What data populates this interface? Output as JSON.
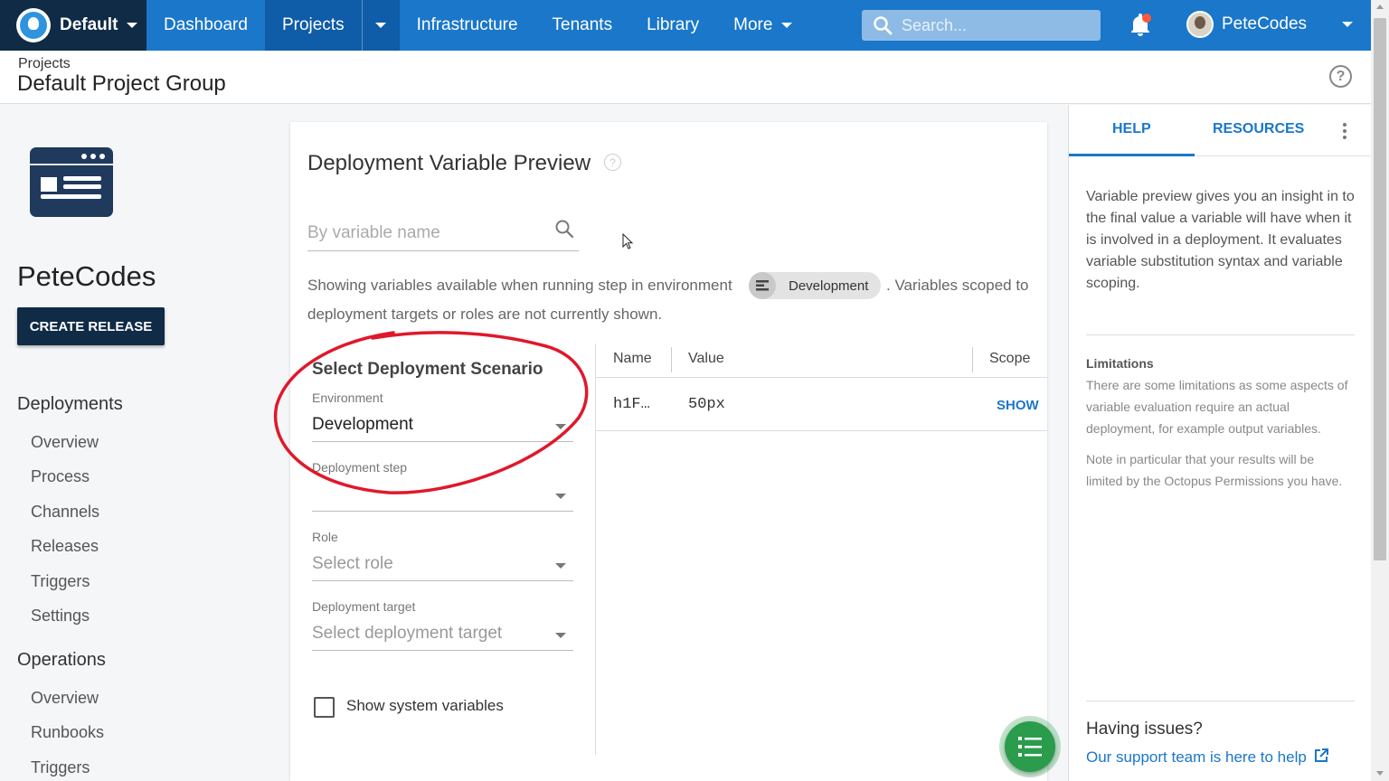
{
  "topbar": {
    "space": "Default",
    "nav": [
      "Dashboard",
      "Projects",
      "Infrastructure",
      "Tenants",
      "Library",
      "More"
    ],
    "search_placeholder": "Search...",
    "user": "PeteCodes"
  },
  "header": {
    "breadcrumb": "Projects",
    "title": "Default Project Group",
    "help_icon": "?"
  },
  "leftnav": {
    "project_name": "PeteCodes",
    "create_release": "CREATE RELEASE",
    "deployments_title": "Deployments",
    "deployments": [
      "Overview",
      "Process",
      "Channels",
      "Releases",
      "Triggers",
      "Settings"
    ],
    "operations_title": "Operations",
    "operations": [
      "Overview",
      "Runbooks",
      "Triggers"
    ]
  },
  "main": {
    "title": "Deployment Variable Preview",
    "title_help_icon": "?",
    "filter_placeholder": "By variable name",
    "info_before": "Showing variables available when running step in environment",
    "environment_chip": "Development",
    "info_after": ". Variables scoped to",
    "info_line2": "deployment targets or roles are not currently shown.",
    "scenario": {
      "title": "Select Deployment Scenario",
      "environment_label": "Environment",
      "environment_value": "Development",
      "step_label": "Deployment step",
      "role_label": "Role",
      "role_placeholder": "Select role",
      "target_label": "Deployment target",
      "target_placeholder": "Select deployment target",
      "system_vars_label": "Show system variables"
    },
    "table": {
      "headers": [
        "Name",
        "Value",
        "Scope"
      ],
      "rows": [
        {
          "name": "h1F…",
          "value": "50px",
          "scope": "SHOW"
        }
      ]
    }
  },
  "rpanel": {
    "tabs": [
      "HELP",
      "RESOURCES"
    ],
    "help_text": "Variable preview gives you an insight in to the final value a variable will have when it is involved in a deployment. It evaluates variable substitution syntax and variable scoping.",
    "limitations_title": "Limitations",
    "limitations_p1": "There are some limitations as some aspects of variable evaluation require an actual deployment, for example output variables.",
    "limitations_p2": "Note in particular that your results will be limited by the Octopus Permissions you have.",
    "issues_title": "Having issues?",
    "support_link": "Our support team is here to help"
  },
  "colors": {
    "brand_blue": "#1a77ca",
    "navy": "#0f2b46",
    "annotation_red": "#e0182b",
    "fab_green": "#2a9c4c"
  },
  "icons": [
    "octopus-logo-icon",
    "chevron-down-icon",
    "search-icon",
    "bell-icon",
    "help-icon",
    "filter-search-icon",
    "environment-icon",
    "checkbox-icon",
    "list-icon",
    "kebab-icon",
    "external-link-icon"
  ]
}
